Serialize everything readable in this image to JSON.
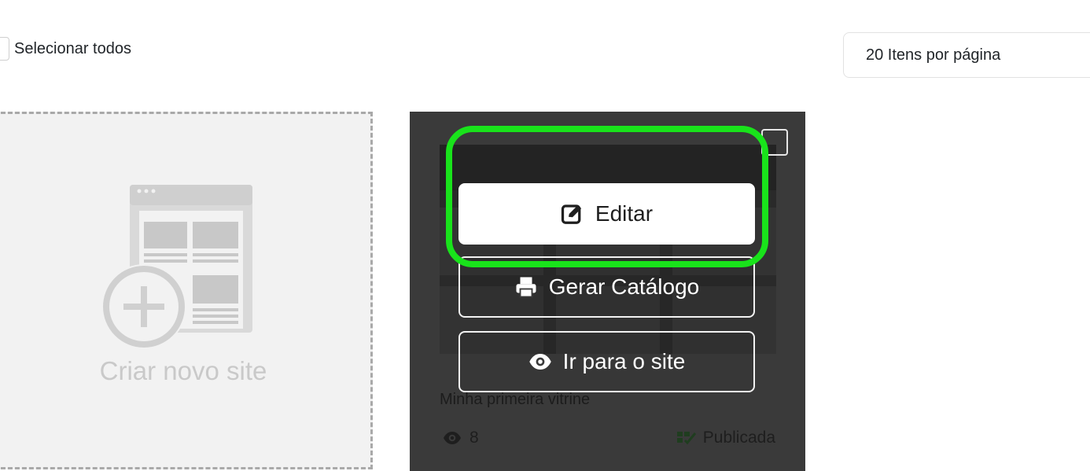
{
  "toolbar": {
    "select_all_label": "Selecionar todos",
    "per_page_label": "20 Itens por página"
  },
  "create_card": {
    "label": "Criar novo site",
    "icon": "site-add-illustration-icon"
  },
  "site_card": {
    "title": "Minha primeira vitrine",
    "views": "8",
    "status": "Publicada",
    "actions": {
      "edit": "Editar",
      "catalog": "Gerar Catálogo",
      "visit": "Ir para o site"
    }
  },
  "colors": {
    "card_overlay": "#3a3a3a",
    "highlight": "#19e31b",
    "status": "#2e6b2f"
  }
}
